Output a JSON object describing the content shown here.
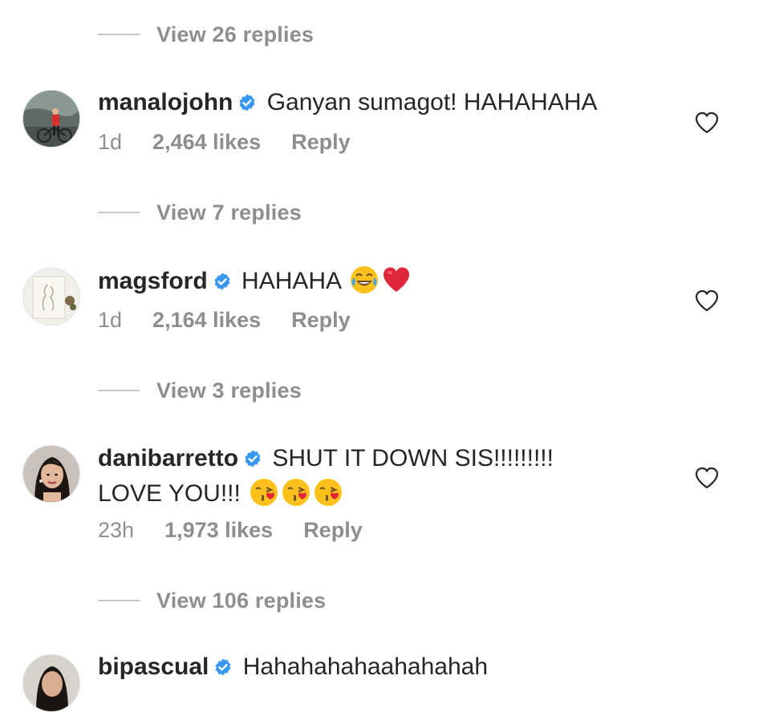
{
  "thread": {
    "top_view_replies": "View 26 replies",
    "comments": [
      {
        "username": "manalojohn",
        "text": "Ganyan sumagot! HAHAHAHA",
        "time": "1d",
        "likes": "2,464 likes",
        "reply": "Reply",
        "view_replies": "View 7 replies"
      },
      {
        "username": "magsford",
        "text": "HAHAHA",
        "emojis": [
          "face-with-tears-of-joy",
          "red-heart"
        ],
        "time": "1d",
        "likes": "2,164 likes",
        "reply": "Reply",
        "view_replies": "View 3 replies"
      },
      {
        "username": "danibarretto",
        "text_line1": "SHUT IT DOWN SIS!!!!!!!!!",
        "text_line2": "LOVE YOU!!!",
        "emojis": [
          "face-blowing-a-kiss",
          "face-blowing-a-kiss",
          "face-blowing-a-kiss"
        ],
        "time": "23h",
        "likes": "1,973 likes",
        "reply": "Reply",
        "view_replies": "View 106 replies"
      },
      {
        "username": "bipascual",
        "text": "Hahahahahaahahahah"
      }
    ]
  },
  "icons": {
    "verified": "verified-badge-icon",
    "like": "heart-outline-icon"
  },
  "colors": {
    "text": "#262626",
    "secondary": "#8e8e8e",
    "verified": "#3897f0",
    "divider": "#c7c7c7"
  }
}
